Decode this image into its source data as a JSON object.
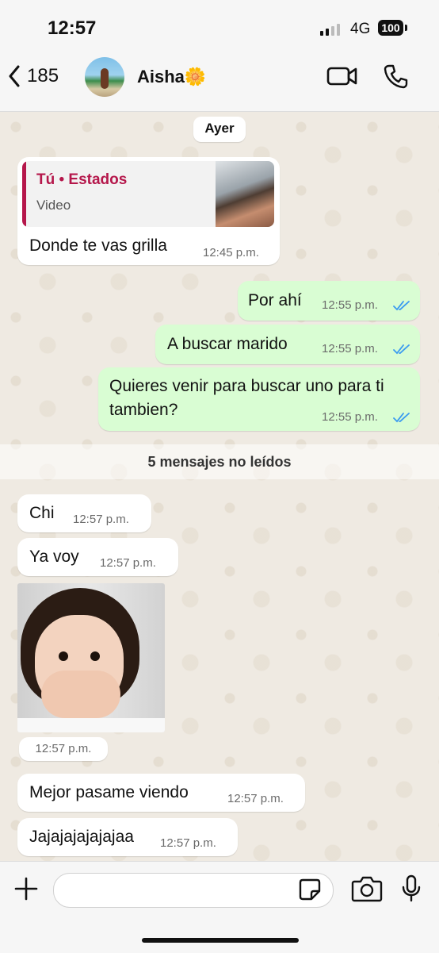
{
  "status_bar": {
    "time": "12:57",
    "network": "4G",
    "battery": "100"
  },
  "header": {
    "back_count": "185",
    "contact_name": "Aisha🌼"
  },
  "date_label": "Ayer",
  "messages": [
    {
      "reply_title": "Tú • Estados",
      "reply_subtitle": "Video",
      "text": "Donde te vas grilla",
      "time": "12:45 p.m."
    },
    {
      "text": "Por ahí",
      "time": "12:55 p.m."
    },
    {
      "text": "A buscar marido",
      "time": "12:55 p.m."
    },
    {
      "text": "Quieres venir para buscar uno para ti tambien?",
      "time": "12:55 p.m."
    },
    {
      "text": "Chi",
      "time": "12:57 p.m."
    },
    {
      "text": "Ya voy",
      "time": "12:57 p.m."
    },
    {
      "time": "12:57 p.m."
    },
    {
      "text": "Mejor pasame viendo",
      "time": "12:57 p.m."
    },
    {
      "text": "Jajajajajajajaa",
      "time": "12:57 p.m."
    }
  ],
  "unread_label": "5 mensajes no leídos",
  "colors": {
    "read_ticks": "#3b9bf0",
    "outgoing_bubble": "#d9fdd3",
    "reply_accent": "#b5174b"
  },
  "icons": [
    "chevron-left-icon",
    "video-call-icon",
    "phone-icon",
    "plus-icon",
    "sticker-icon",
    "camera-icon",
    "microphone-icon",
    "double-check-icon"
  ]
}
